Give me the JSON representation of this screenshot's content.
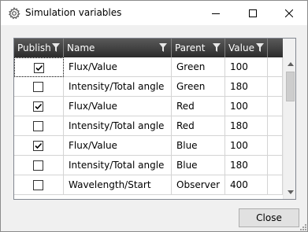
{
  "window": {
    "title": "Simulation variables",
    "icon": "gear-icon"
  },
  "grid": {
    "columns": [
      "Publish",
      "Name",
      "Parent",
      "Value"
    ],
    "rows": [
      {
        "publish": true,
        "name": "Flux/Value",
        "parent": "Green",
        "value": "100"
      },
      {
        "publish": false,
        "name": "Intensity/Total angle",
        "parent": "Green",
        "value": "180"
      },
      {
        "publish": true,
        "name": "Flux/Value",
        "parent": "Red",
        "value": "100"
      },
      {
        "publish": false,
        "name": "Intensity/Total angle",
        "parent": "Red",
        "value": "180"
      },
      {
        "publish": true,
        "name": "Flux/Value",
        "parent": "Blue",
        "value": "100"
      },
      {
        "publish": false,
        "name": "Intensity/Total angle",
        "parent": "Blue",
        "value": "180"
      },
      {
        "publish": false,
        "name": "Wavelength/Start",
        "parent": "Observer",
        "value": "400"
      }
    ]
  },
  "footer": {
    "close_label": "Close"
  }
}
